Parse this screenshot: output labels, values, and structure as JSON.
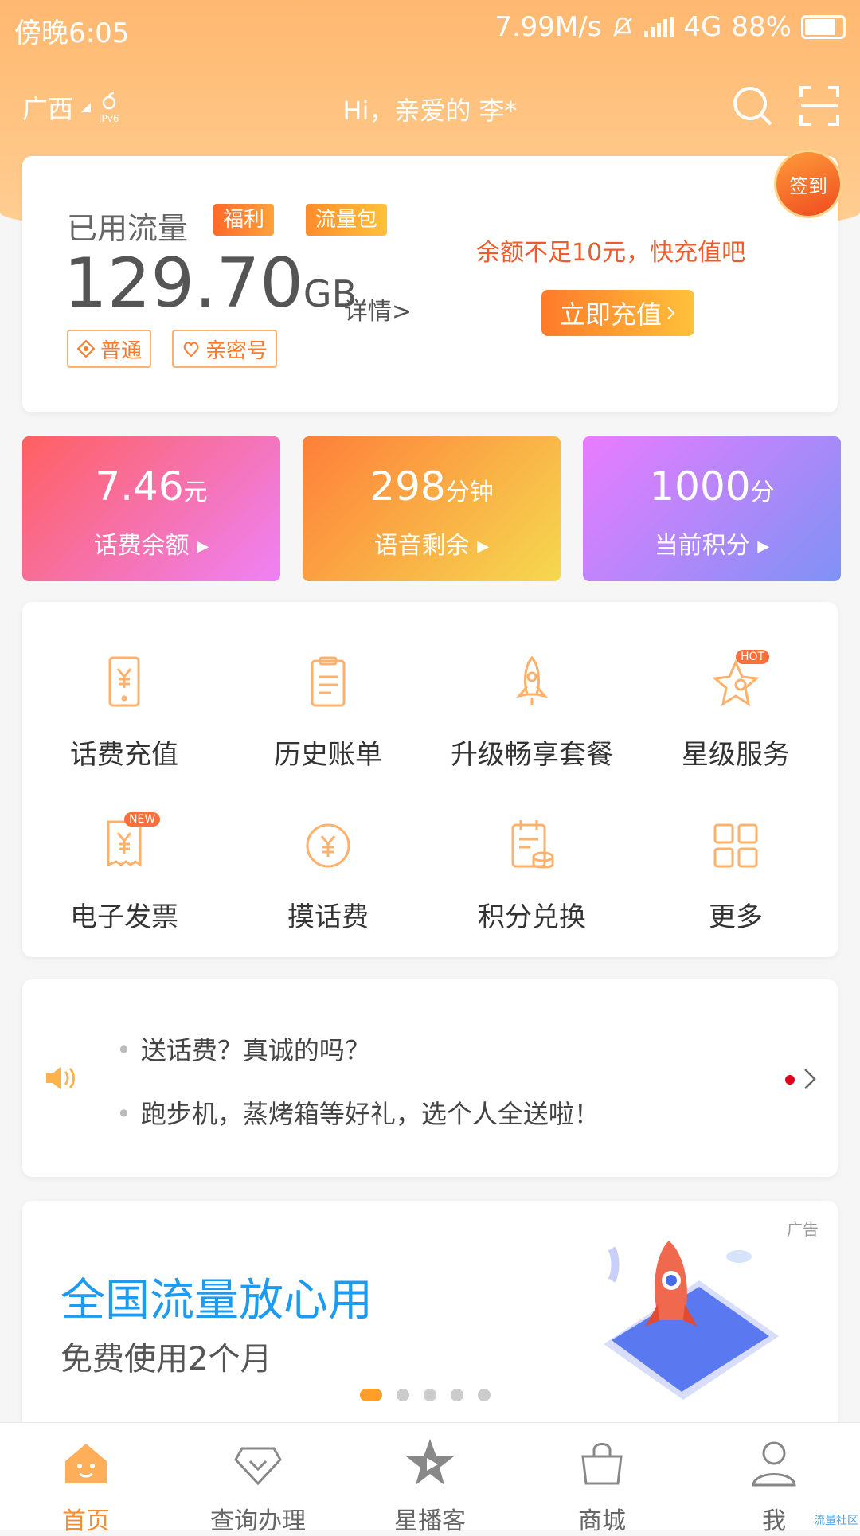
{
  "status_bar": {
    "time": "傍晚6:05",
    "speed": "7.99M/s",
    "network": "4G",
    "battery": "88%"
  },
  "header": {
    "region": "广西",
    "ipv6_label": "IPv6",
    "greeting": "Hi，亲爱的 李*"
  },
  "flow": {
    "title": "已用流量",
    "tag1": "福利",
    "tag2": "流量包",
    "value": "129.70",
    "unit": "GB",
    "detail": "详情>",
    "pill1": "普通",
    "pill2": "亲密号",
    "warning": "余额不足10元，快充值吧",
    "recharge": "立即充值",
    "signin": "签到"
  },
  "stats": [
    {
      "value": "7.46",
      "unit": "元",
      "label": "话费余额"
    },
    {
      "value": "298",
      "unit": "分钟",
      "label": "语音剩余"
    },
    {
      "value": "1000",
      "unit": "分",
      "label": "当前积分"
    }
  ],
  "services": [
    {
      "label": "话费充值",
      "icon": "phone-yuan-icon"
    },
    {
      "label": "历史账单",
      "icon": "clipboard-icon"
    },
    {
      "label": "升级畅享套餐",
      "icon": "rocket-icon"
    },
    {
      "label": "星级服务",
      "icon": "star-icon",
      "badge": "HOT"
    },
    {
      "label": "电子发票",
      "icon": "invoice-icon",
      "badge": "NEW"
    },
    {
      "label": "摸话费",
      "icon": "coin-icon"
    },
    {
      "label": "积分兑换",
      "icon": "calendar-coins-icon"
    },
    {
      "label": "更多",
      "icon": "grid-icon"
    }
  ],
  "news": [
    "送话费？真诚的吗？",
    "跑步机，蒸烤箱等好礼，选个人全送啦！"
  ],
  "banner": {
    "ad_label": "广告",
    "title": "全国流量放心用",
    "subtitle": "免费使用2个月"
  },
  "tabs": [
    {
      "label": "首页",
      "icon": "home-icon",
      "active": true
    },
    {
      "label": "查询办理",
      "icon": "diamond-icon"
    },
    {
      "label": "星播客",
      "icon": "star-play-icon"
    },
    {
      "label": "商城",
      "icon": "bag-icon"
    },
    {
      "label": "我",
      "icon": "user-icon"
    }
  ],
  "watermark": "流量社区",
  "colors": {
    "accent": "#ff8c2a",
    "header": "#ffb870",
    "banner_title": "#1d9bf0"
  }
}
